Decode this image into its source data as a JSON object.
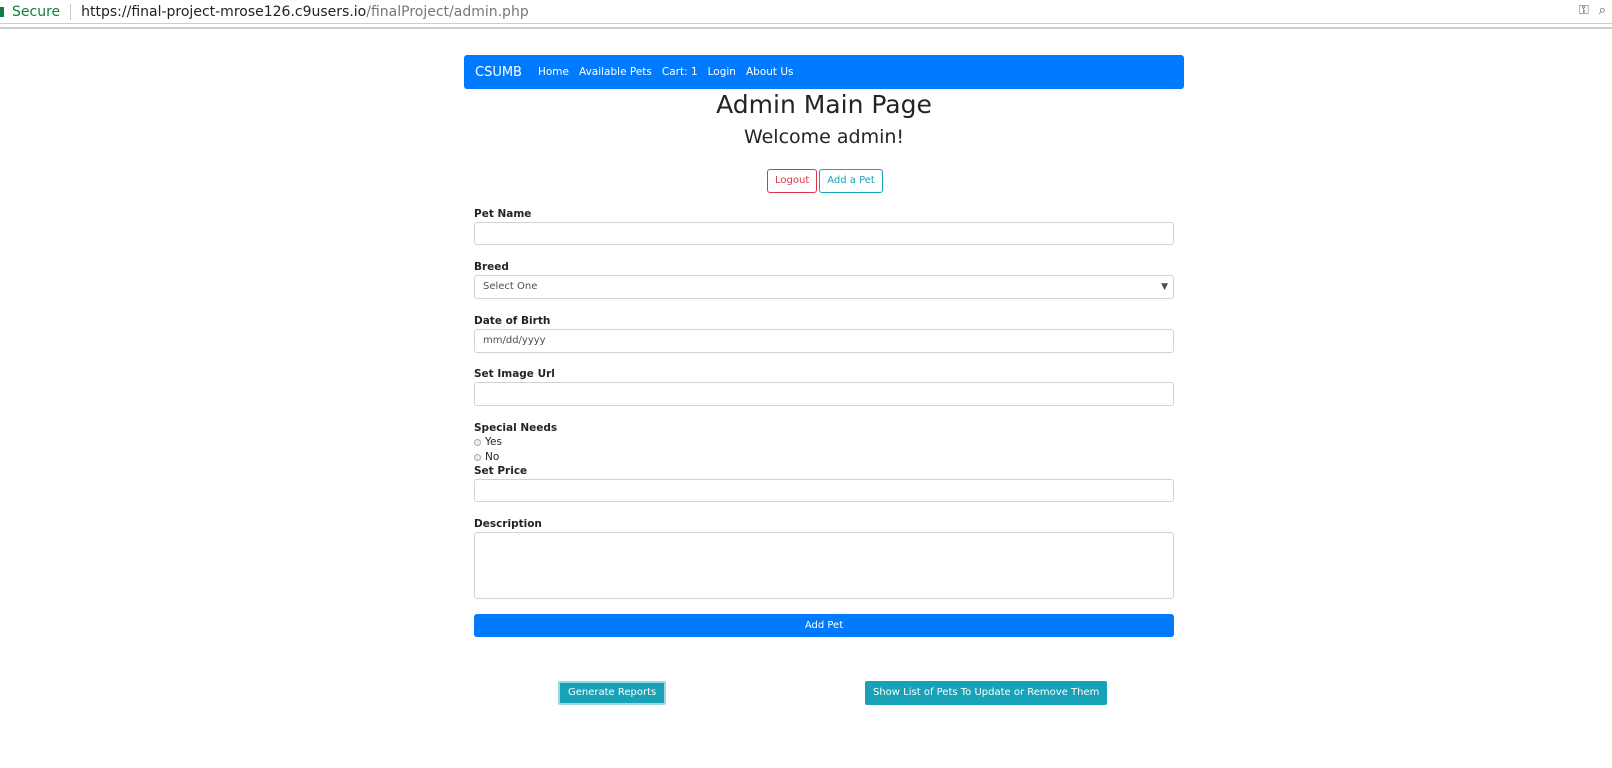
{
  "browser": {
    "secure": "Secure",
    "url_host": "https://final-project-mrose126.c9users.io",
    "url_path": "/finalProject/admin.php"
  },
  "nav": {
    "brand": "CSUMB",
    "links": [
      "Home",
      "Available Pets",
      "Cart: 1",
      "Login",
      "About Us"
    ]
  },
  "title": "Admin Main Page",
  "welcome": "Welcome admin!",
  "buttons": {
    "logout": "Logout",
    "add_a_pet": "Add a Pet",
    "add_pet": "Add Pet",
    "reports": "Generate Reports",
    "list": "Show List of Pets To Update or Remove Them"
  },
  "form": {
    "pet_name": "Pet Name",
    "breed": "Breed",
    "breed_selected": "Select One",
    "dob": "Date of Birth",
    "dob_placeholder": "mm/dd/yyyy",
    "image": "Set Image Url",
    "special": "Special Needs",
    "yes": "Yes",
    "no": "No",
    "price": "Set Price",
    "description": "Description"
  }
}
